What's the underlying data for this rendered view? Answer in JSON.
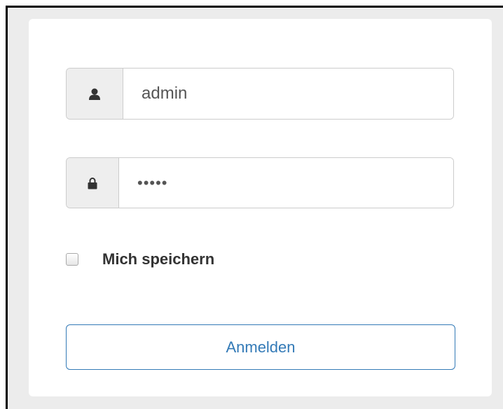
{
  "login": {
    "username": {
      "value": "admin",
      "icon": "user-icon"
    },
    "password": {
      "value": "•••••",
      "icon": "lock-icon"
    },
    "remember": {
      "label": "Mich speichern",
      "checked": false
    },
    "submit_label": "Anmelden"
  },
  "colors": {
    "primary": "#337ab7",
    "panel_background": "#ffffff",
    "page_background": "#ececec",
    "addon_background": "#eeeeee",
    "border": "#cccccc"
  }
}
